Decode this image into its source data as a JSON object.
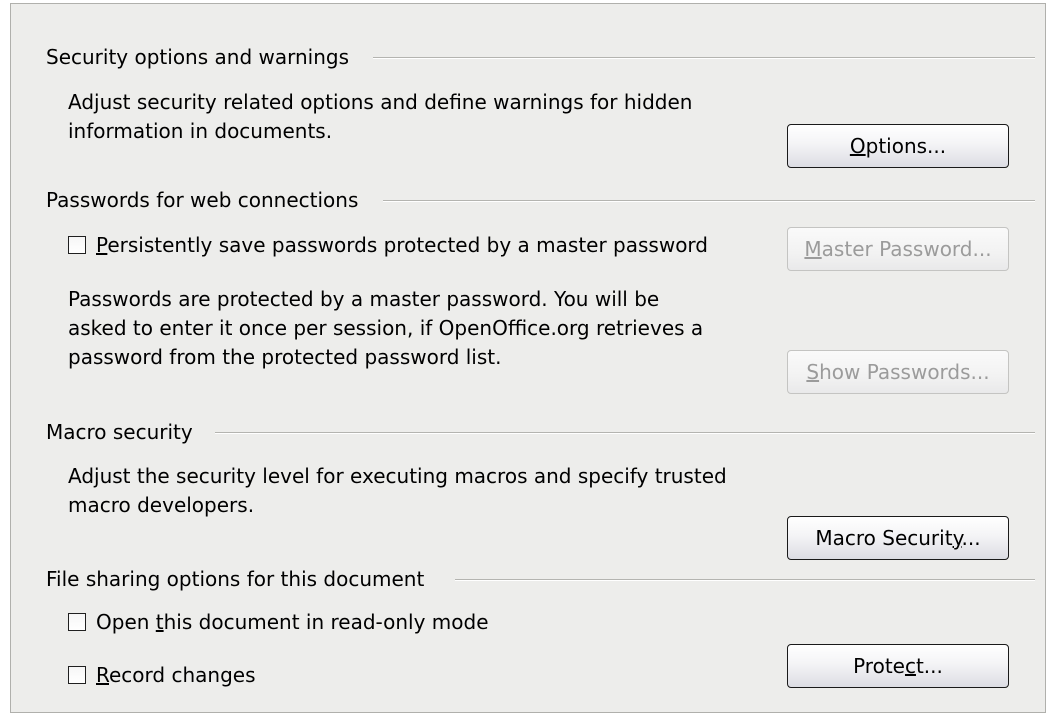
{
  "sections": {
    "security": {
      "title": "Security options and warnings",
      "description_lines": [
        "Adjust security related options and define warnings for hidden",
        "information in documents."
      ],
      "options_button": {
        "before": "",
        "mnemonic": "O",
        "after": "ptions..."
      }
    },
    "passwords": {
      "title": "Passwords for web connections",
      "persist_checkbox": {
        "mnemonic": "P",
        "after": "ersistently save passwords protected by a master password",
        "checked": false
      },
      "master_password_button": {
        "before": "",
        "mnemonic": "M",
        "after": "aster Password...",
        "enabled": false
      },
      "description_lines": [
        "Passwords are protected by a master password. You will be",
        "asked to enter it once per session, if OpenOffice.org retrieves a",
        "password from the protected password list."
      ],
      "show_passwords_button": {
        "before": "",
        "mnemonic": "S",
        "after": "how Passwords...",
        "enabled": false
      }
    },
    "macro": {
      "title": "Macro security",
      "description_lines": [
        "Adjust the security level for executing macros and specify trusted",
        "macro developers."
      ],
      "macro_security_button": {
        "before": "Macro Securit",
        "mnemonic": "y",
        "after": "..."
      }
    },
    "file_sharing": {
      "title": "File sharing options for this document",
      "readonly_checkbox": {
        "before": "Open ",
        "mnemonic": "t",
        "after": "his document in read-only mode",
        "checked": false
      },
      "record_checkbox": {
        "before": "",
        "mnemonic": "R",
        "after": "ecord changes",
        "checked": false
      },
      "protect_button": {
        "before": "Prote",
        "mnemonic": "c",
        "after": "t..."
      }
    }
  }
}
